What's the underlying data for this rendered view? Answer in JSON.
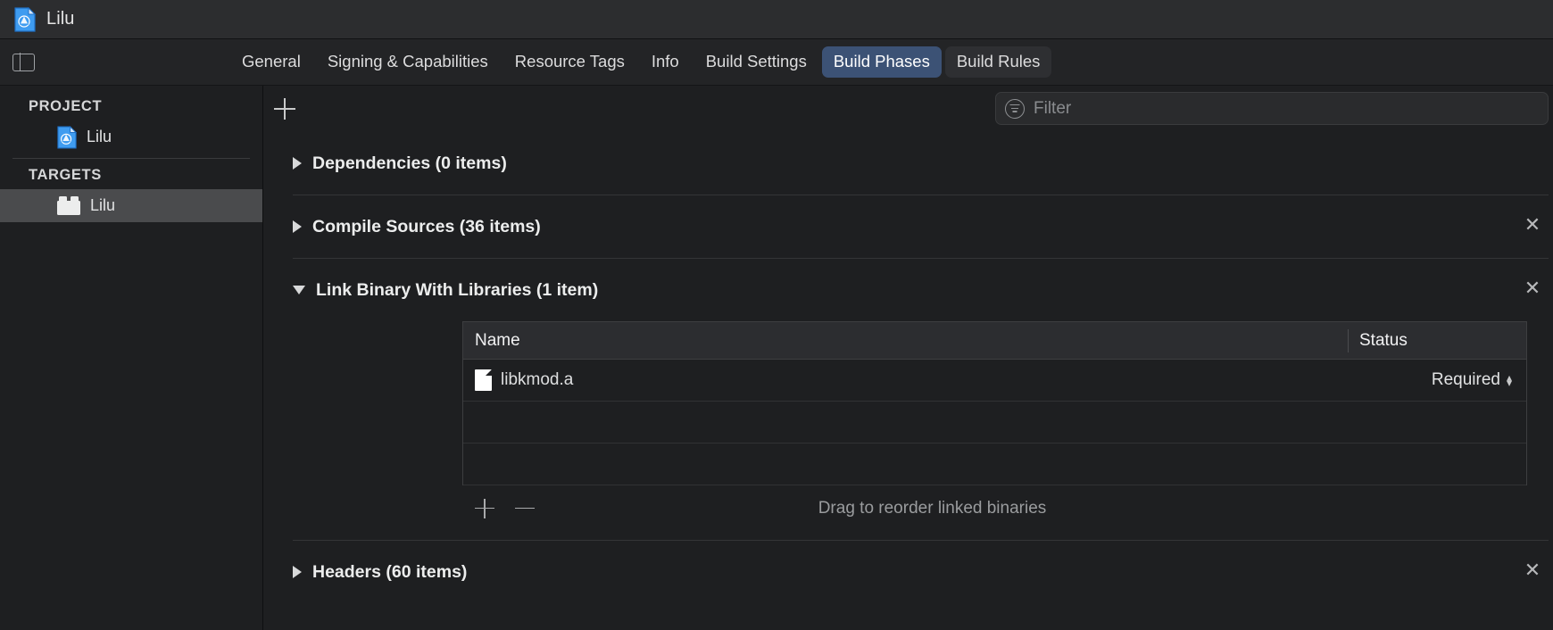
{
  "window": {
    "title": "Lilu",
    "doc_icon": "xcodeproj-icon"
  },
  "tabbar": {
    "sidebar_toggle_icon": "sidebar-panel-icon",
    "tabs": [
      {
        "label": "General",
        "state": "normal"
      },
      {
        "label": "Signing & Capabilities",
        "state": "normal"
      },
      {
        "label": "Resource Tags",
        "state": "normal"
      },
      {
        "label": "Info",
        "state": "normal"
      },
      {
        "label": "Build Settings",
        "state": "normal"
      },
      {
        "label": "Build Phases",
        "state": "selected"
      },
      {
        "label": "Build Rules",
        "state": "rest"
      }
    ],
    "selected_tab": "Build Phases",
    "selected_color": "#3c5275"
  },
  "sidebar": {
    "project_group_label": "PROJECT",
    "targets_group_label": "TARGETS",
    "project_items": [
      {
        "label": "Lilu",
        "icon": "xcodeproj-icon",
        "selected": false
      }
    ],
    "target_items": [
      {
        "label": "Lilu",
        "icon": "bundle-target-icon",
        "selected": true
      }
    ],
    "selection_color": "#4a4b4d"
  },
  "toolbar": {
    "add_phase_icon": "plus-icon",
    "filter_icon": "filter-icon",
    "filter_placeholder": "Filter",
    "filter_value": ""
  },
  "phases": [
    {
      "name": "Dependencies",
      "count_label": "(0 items)",
      "title": "Dependencies (0 items)",
      "expanded": false,
      "removable": false
    },
    {
      "name": "Compile Sources",
      "count_label": "(36 items)",
      "title": "Compile Sources (36 items)",
      "expanded": false,
      "removable": true
    },
    {
      "name": "Link Binary With Libraries",
      "count_label": "(1 item)",
      "title": "Link Binary With Libraries (1 item)",
      "expanded": true,
      "removable": true,
      "table": {
        "columns": [
          "Name",
          "Status"
        ],
        "rows": [
          {
            "name": "libkmod.a",
            "icon": "file-page-icon",
            "status": "Required"
          }
        ],
        "empty_rows": 2,
        "footer": {
          "add_icon": "plus-icon",
          "remove_icon": "minus-icon",
          "hint": "Drag to reorder linked binaries"
        }
      }
    },
    {
      "name": "Headers",
      "count_label": "(60 items)",
      "title": "Headers (60 items)",
      "expanded": false,
      "removable": true
    }
  ],
  "glyphs": {
    "close": "✕",
    "chevron_up": "▴",
    "chevron_down": "▾"
  }
}
